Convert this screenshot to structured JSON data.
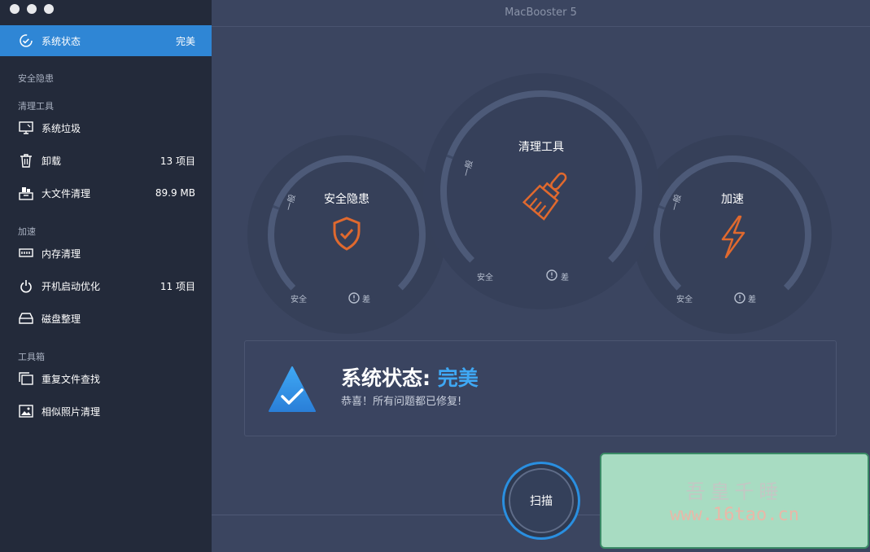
{
  "window": {
    "title": "MacBooster 5"
  },
  "sidebar": {
    "status_item": {
      "label": "系统状态",
      "value": "完美",
      "icon": "gauge-check-icon"
    },
    "sections": {
      "security": "安全隐患",
      "cleanup": "清理工具",
      "speed": "加速",
      "toolbox": "工具箱"
    },
    "items": [
      {
        "label": "系统垃圾",
        "count": "",
        "icon": "monitor-icon"
      },
      {
        "label": "卸载",
        "count": "13 项目",
        "icon": "trash-icon"
      },
      {
        "label": "大文件清理",
        "count": "89.9 MB",
        "icon": "drawer-files-icon"
      },
      {
        "label": "内存清理",
        "count": "",
        "icon": "memory-icon"
      },
      {
        "label": "开机启动优化",
        "count": "11 项目",
        "icon": "power-icon"
      },
      {
        "label": "磁盘整理",
        "count": "",
        "icon": "disk-icon"
      },
      {
        "label": "重复文件查找",
        "count": "",
        "icon": "duplicate-files-icon"
      },
      {
        "label": "相似照片清理",
        "count": "",
        "icon": "photo-icon"
      }
    ]
  },
  "gauges": [
    {
      "title": "安全隐患",
      "level_label": "一般",
      "safe": "安全",
      "bad": "差",
      "icon": "shield-check-icon"
    },
    {
      "title": "清理工具",
      "level_label": "一般",
      "safe": "安全",
      "bad": "差",
      "icon": "brush-icon"
    },
    {
      "title": "加速",
      "level_label": "一般",
      "safe": "安全",
      "bad": "差",
      "icon": "lightning-icon"
    }
  ],
  "status": {
    "title_prefix": "系统状态:",
    "title_value": "完美",
    "subtitle": "恭喜！所有问题都已修复!",
    "icon": "triangle-check-icon"
  },
  "scan": {
    "label": "扫描"
  },
  "watermark": {
    "line1": "吾皇千睡",
    "line2": "www.16tao.cn"
  },
  "colors": {
    "accent": "#2f86d5",
    "status_value": "#3fa8f4",
    "icon_orange": "#e0692e"
  }
}
